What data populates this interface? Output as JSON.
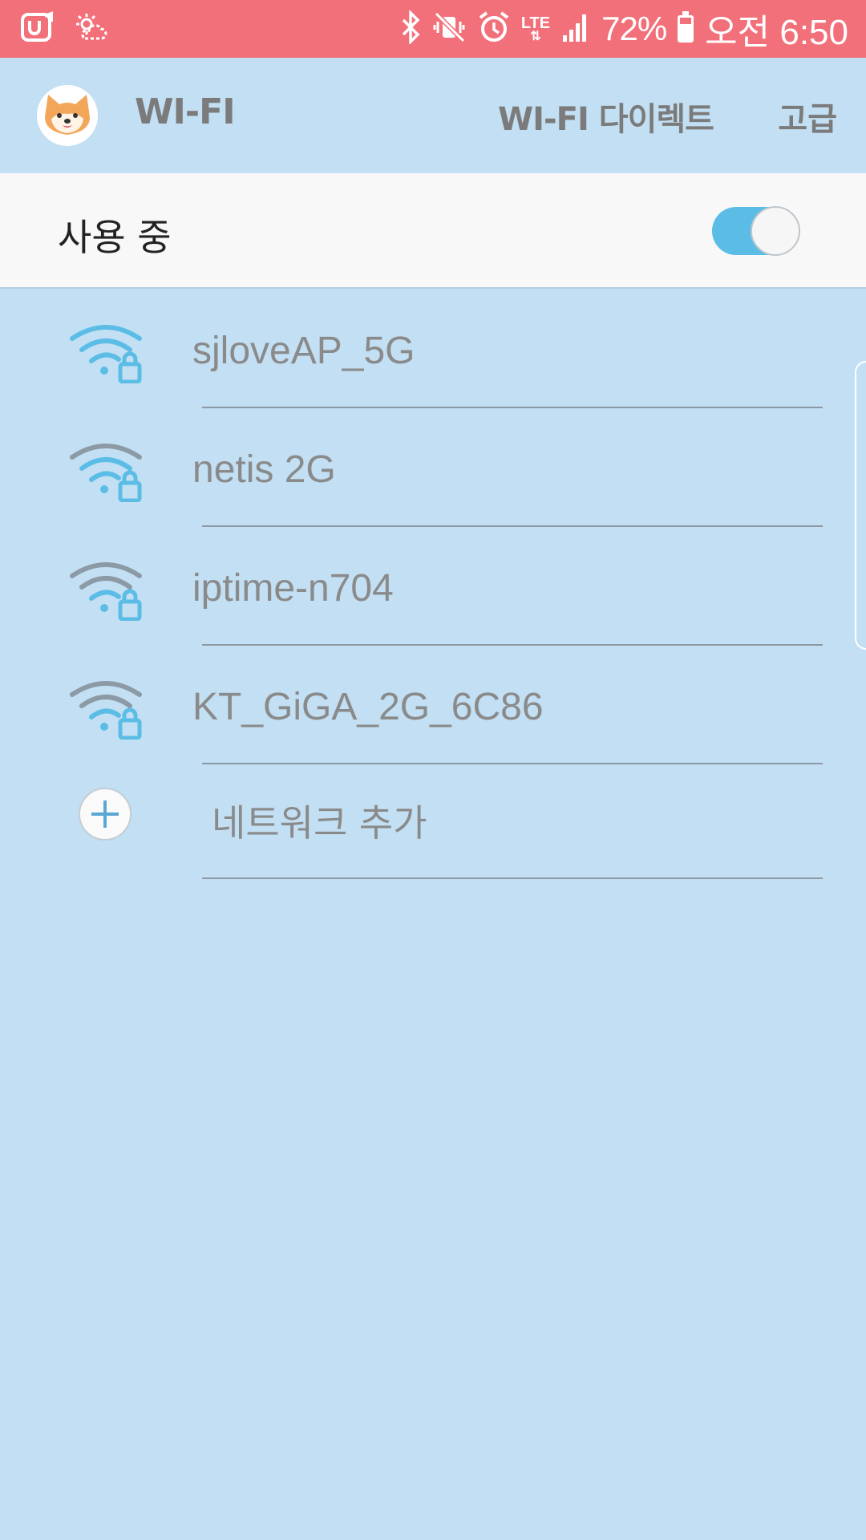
{
  "status_bar": {
    "battery_text": "72%",
    "time": "오전 6:50",
    "network_type": "LTE",
    "color": "#f2707a"
  },
  "app_bar": {
    "title": "WI-FI",
    "direct_label": "WI-FI 다이렉트",
    "advanced_label": "고급",
    "avatar_icon": "shiba-dog-avatar"
  },
  "toggle": {
    "label": "사용 중",
    "on": true,
    "accent": "#5bbde6"
  },
  "networks": [
    {
      "ssid": "sjloveAP_5G",
      "secured": true,
      "active": true
    },
    {
      "ssid": "netis 2G",
      "secured": true,
      "active": false
    },
    {
      "ssid": "iptime-n704",
      "secured": true,
      "active": false
    },
    {
      "ssid": "KT_GiGA_2G_6C86",
      "secured": true,
      "active": false
    }
  ],
  "add_network": {
    "label": "네트워크 추가"
  }
}
